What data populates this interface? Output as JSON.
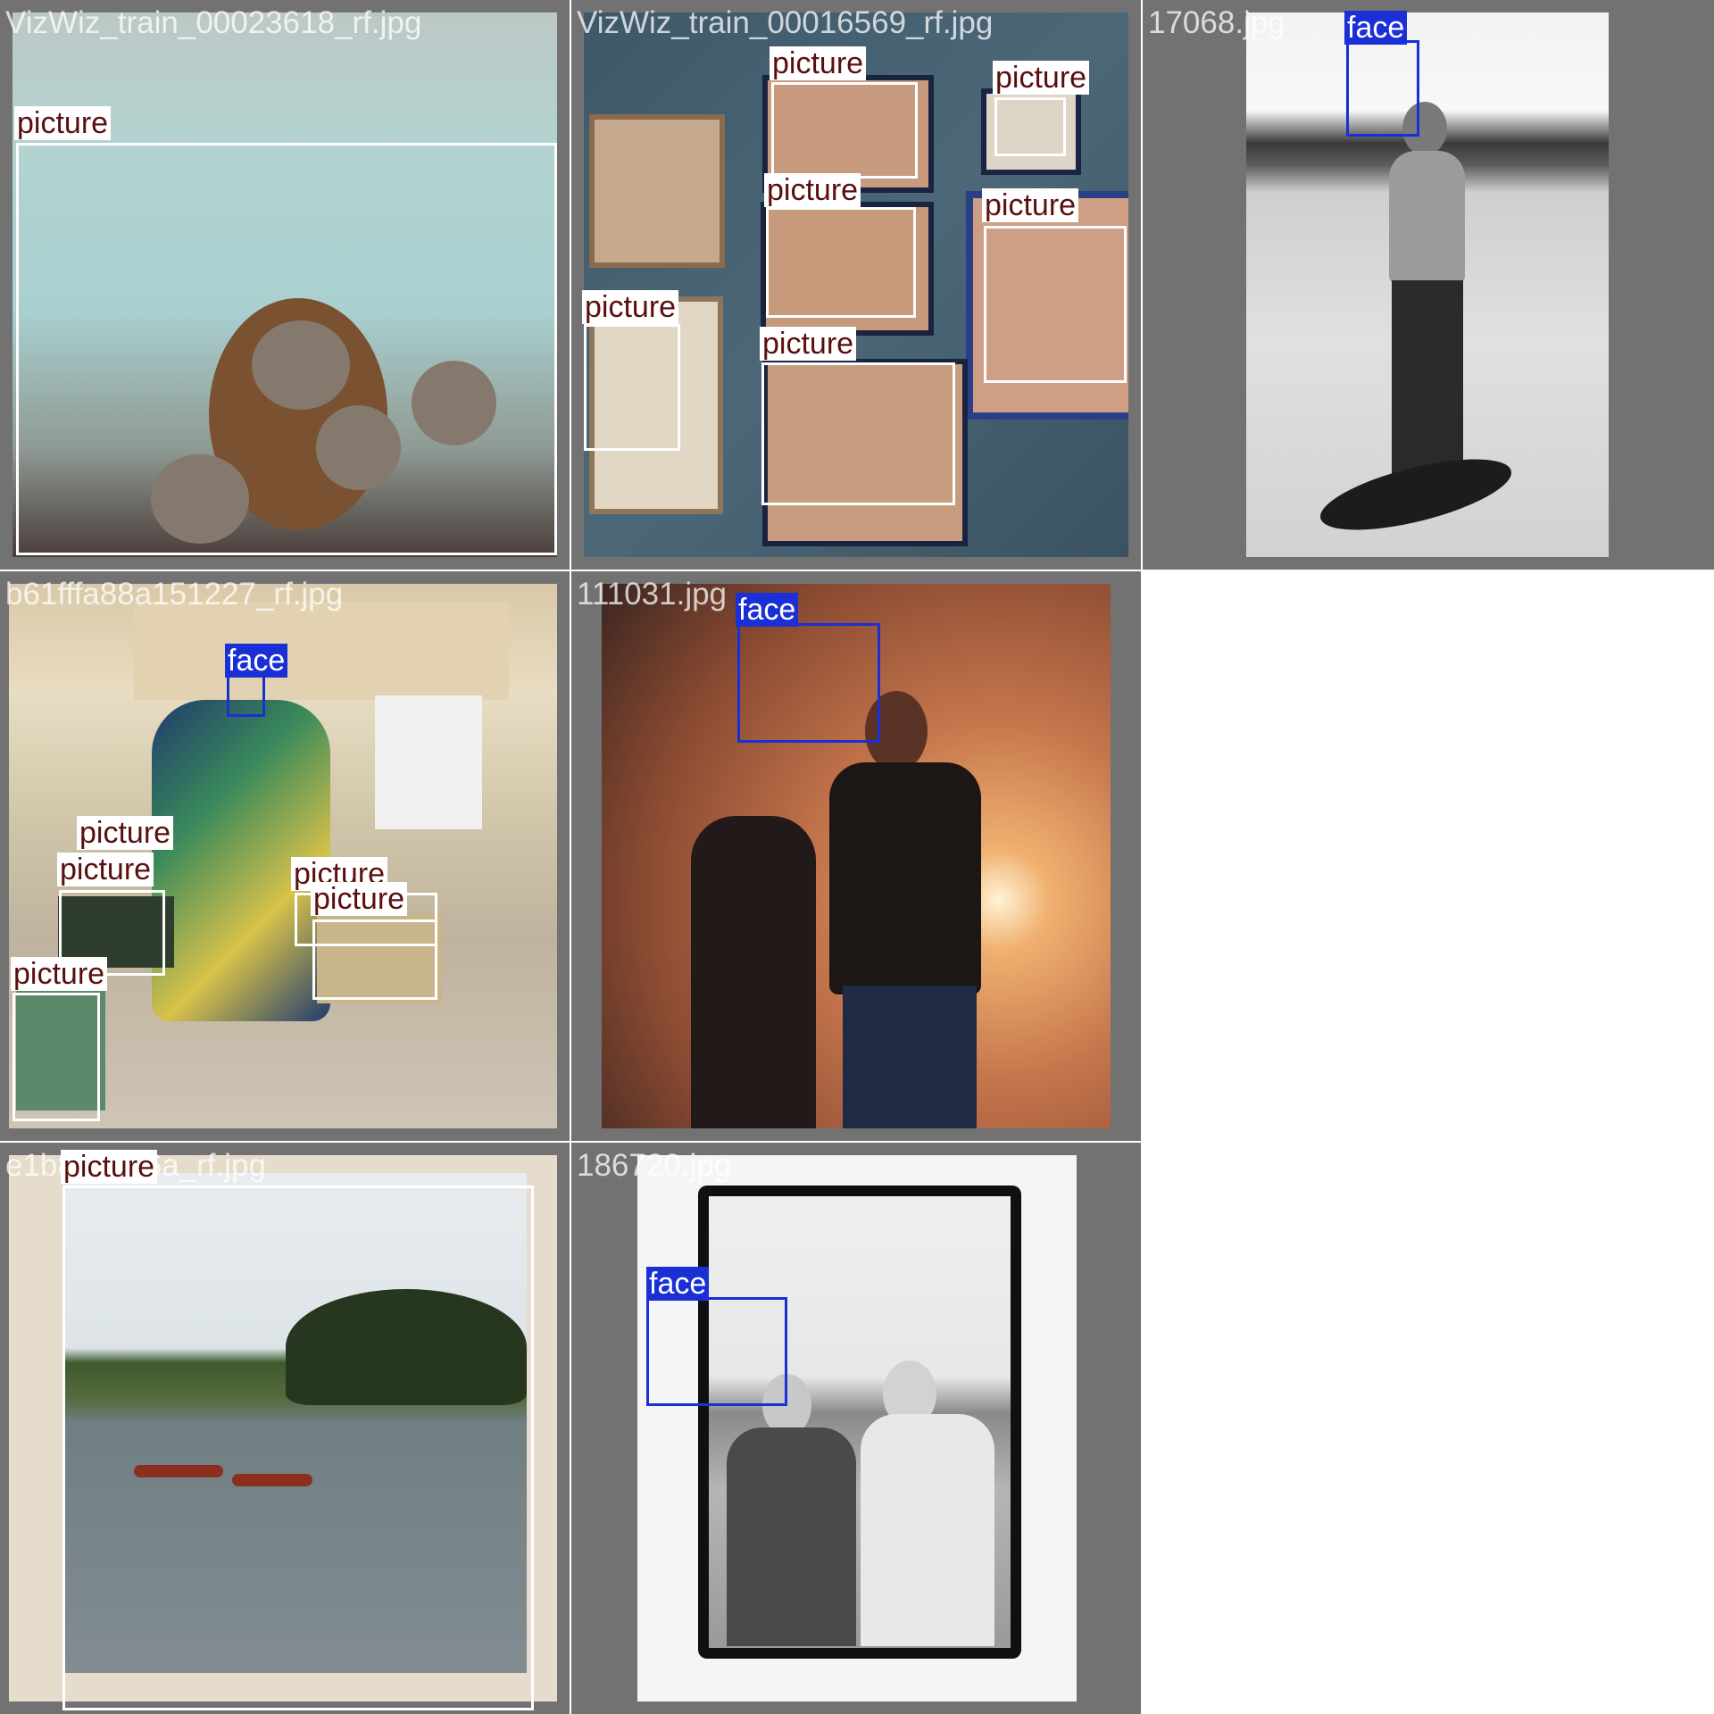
{
  "colors": {
    "tile_background": "#727272",
    "picture_box": "#ffffff",
    "picture_label_text": "#5a0f0f",
    "face_box": "#1a2fd6",
    "face_label_text": "#ffffff"
  },
  "tiles": [
    {
      "filename": "VizWiz_train_00023618_rf.jpg",
      "labels": [
        "picture"
      ]
    },
    {
      "filename": "VizWiz_train_00016569_rf.jpg",
      "labels": [
        "picture",
        "picture",
        "picture",
        "picture",
        "picture",
        "picture"
      ]
    },
    {
      "filename": "17068.jpg",
      "labels": [
        "face"
      ]
    },
    {
      "filename": "b61fffa88a151227_rf.jpg",
      "labels": [
        "face",
        "picture",
        "picture",
        "picture",
        "picture",
        "picture"
      ]
    },
    {
      "filename": "111031.jpg",
      "labels": [
        "face"
      ]
    },
    {
      "filename": "e1b829ad6a_rf.jpg",
      "labels": [
        "picture"
      ]
    },
    {
      "filename": "186720.jpg",
      "labels": [
        "face"
      ]
    }
  ]
}
